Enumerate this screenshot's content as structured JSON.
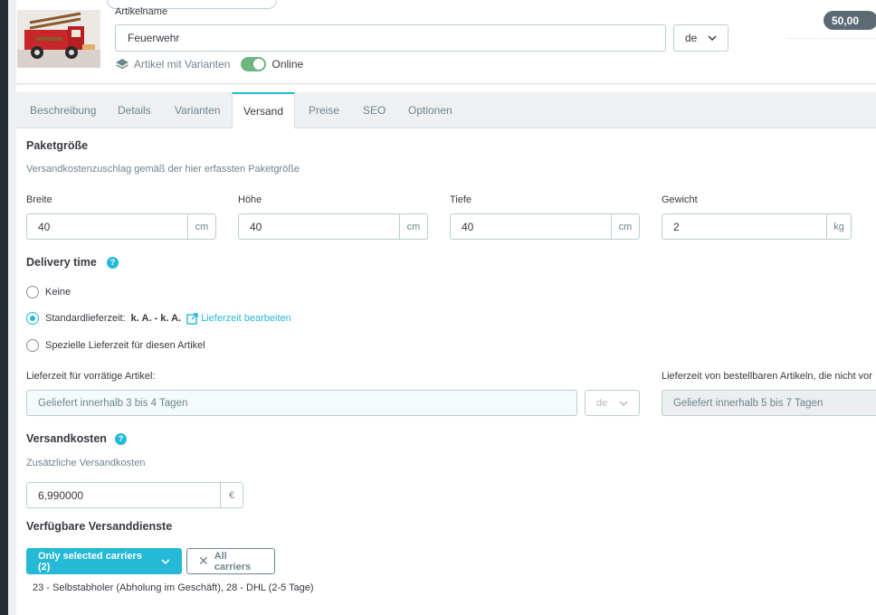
{
  "header": {
    "name_label": "Artikelname",
    "name_value": "Feuerwehr",
    "language": "de",
    "variants_label": "Artikel mit Varianten",
    "online_label": "Online",
    "price_badge": "50,00"
  },
  "tabs": [
    {
      "label": "Beschreibung"
    },
    {
      "label": "Details"
    },
    {
      "label": "Varianten"
    },
    {
      "label": "Versand",
      "active": true
    },
    {
      "label": "Preise"
    },
    {
      "label": "SEO"
    },
    {
      "label": "Optionen"
    }
  ],
  "package": {
    "title": "Paketgröße",
    "hint": "Versandkostenzuschlag gemäß der hier erfassten Paketgröße",
    "width": {
      "label": "Breite",
      "value": "40",
      "unit": "cm"
    },
    "height": {
      "label": "Höhe",
      "value": "40",
      "unit": "cm"
    },
    "depth": {
      "label": "Tiefe",
      "value": "40",
      "unit": "cm"
    },
    "weight": {
      "label": "Gewicht",
      "value": "2",
      "unit": "kg"
    }
  },
  "delivery": {
    "title": "Delivery time",
    "help_icon": "?",
    "options": {
      "none": "Keine",
      "standard": "Standardlieferzeit:",
      "standard_value": "k. A. - k. A.",
      "edit_link": "Lieferzeit bearbeiten",
      "special": "Spezielle Lieferzeit für diesen Artikel"
    },
    "selected": "standard",
    "in_stock_label": "Lieferzeit für vorrätige Artikel:",
    "in_stock_value": "Geliefert innerhalb 3 bis 4 Tagen",
    "in_stock_lang": "de",
    "out_of_stock_label": "Lieferzeit von bestellbaren Artikeln, die nicht vor",
    "out_of_stock_value": "Geliefert innerhalb 5 bis 7 Tagen"
  },
  "shipping_cost": {
    "title": "Versandkosten",
    "help_icon": "?",
    "label": "Zusätzliche Versandkosten",
    "value": "6,990000",
    "currency": "€"
  },
  "carriers": {
    "title": "Verfügbare Versanddienste",
    "selected_button": "Only selected carriers (2)",
    "all_button": "All carriers",
    "list_text": "23 - Selbstabholer (Abholung im Geschäft), 28 - DHL (2-5 Tage)"
  },
  "colors": {
    "primary": "#25b9d7",
    "toggle_on": "#70b580",
    "badge": "#5c6b73"
  }
}
